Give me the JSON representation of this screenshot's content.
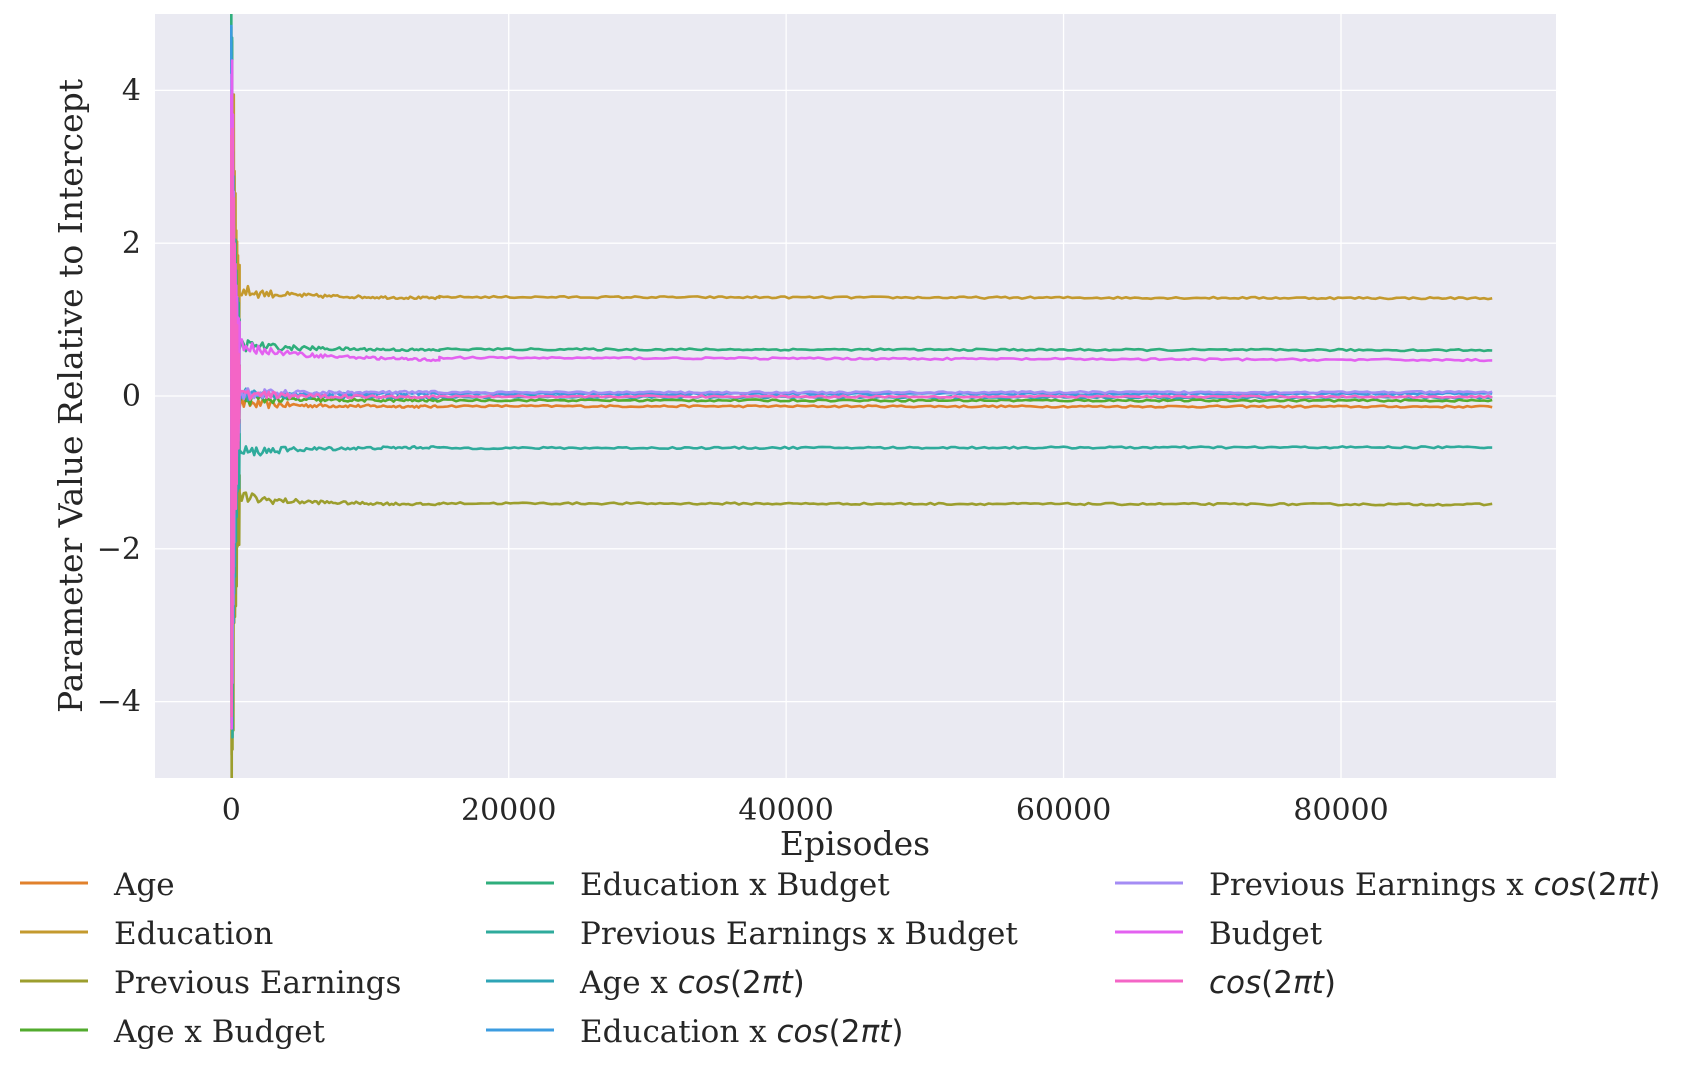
{
  "chart_data": {
    "type": "line",
    "title": "",
    "xlabel": "Episodes",
    "ylabel": "Parameter Value Relative to Intercept",
    "xlim": [
      -5500,
      95500
    ],
    "ylim": [
      -5,
      5
    ],
    "xticks": [
      0,
      20000,
      40000,
      60000,
      80000
    ],
    "xtick_labels": [
      "0",
      "20000",
      "40000",
      "60000",
      "80000"
    ],
    "yticks": [
      -4,
      -2,
      0,
      2,
      4
    ],
    "ytick_labels": [
      "−4",
      "−2",
      "0",
      "2",
      "4"
    ],
    "grid": true,
    "legend_placement": "bottom, three columns",
    "x_end": 91000,
    "series": [
      {
        "name": "Age",
        "name_parts": [
          {
            "t": "Age"
          }
        ],
        "color": "#e1812c",
        "final": -0.14,
        "settle": -0.12
      },
      {
        "name": "Education",
        "name_parts": [
          {
            "t": "Education"
          }
        ],
        "color": "#c49a2e",
        "final": 1.28,
        "settle": 1.32
      },
      {
        "name": "Previous Earnings",
        "name_parts": [
          {
            "t": "Previous Earnings"
          }
        ],
        "color": "#9c9e2e",
        "final": -1.42,
        "settle": -1.38
      },
      {
        "name": "Age x Budget",
        "name_parts": [
          {
            "t": "Age x Budget"
          }
        ],
        "color": "#52ab2e",
        "final": -0.06,
        "settle": -0.05
      },
      {
        "name": "Education x Budget",
        "name_parts": [
          {
            "t": "Education x Budget"
          }
        ],
        "color": "#2fae7c",
        "final": 0.6,
        "settle": 0.63
      },
      {
        "name": "Previous Earnings x Budget",
        "name_parts": [
          {
            "t": "Previous Earnings x Budget"
          }
        ],
        "color": "#2fab9c",
        "final": -0.67,
        "settle": -0.7
      },
      {
        "name": "Age x cos(2πt)",
        "name_parts": [
          {
            "t": "Age x "
          },
          {
            "t": "cos",
            "i": true
          },
          {
            "t": "(2",
            "m": true
          },
          {
            "t": "πt",
            "i": true
          },
          {
            "t": ")",
            "m": true
          }
        ],
        "color": "#2ea4b6",
        "final": -0.02,
        "settle": 0.0
      },
      {
        "name": "Education x cos(2πt)",
        "name_parts": [
          {
            "t": "Education x "
          },
          {
            "t": "cos",
            "i": true
          },
          {
            "t": "(2",
            "m": true
          },
          {
            "t": "πt",
            "i": true
          },
          {
            "t": ")",
            "m": true
          }
        ],
        "color": "#3c9ce0",
        "final": 0.03,
        "settle": 0.02
      },
      {
        "name": "Previous Earnings x cos(2πt)",
        "name_parts": [
          {
            "t": "Previous Earnings x "
          },
          {
            "t": "cos",
            "i": true
          },
          {
            "t": "(2",
            "m": true
          },
          {
            "t": "πt",
            "i": true
          },
          {
            "t": ")",
            "m": true
          }
        ],
        "color": "#a48cf4",
        "final": 0.05,
        "settle": 0.04
      },
      {
        "name": "Budget",
        "name_parts": [
          {
            "t": "Budget"
          }
        ],
        "color": "#e361f0",
        "final": 0.47,
        "settle": 0.55
      },
      {
        "name": "cos(2πt)",
        "name_parts": [
          {
            "t": "cos",
            "i": true
          },
          {
            "t": "(2",
            "m": true
          },
          {
            "t": "πt",
            "i": true
          },
          {
            "t": ")",
            "m": true
          }
        ],
        "color": "#f465c6",
        "final": -0.01,
        "settle": 0.0
      }
    ]
  }
}
